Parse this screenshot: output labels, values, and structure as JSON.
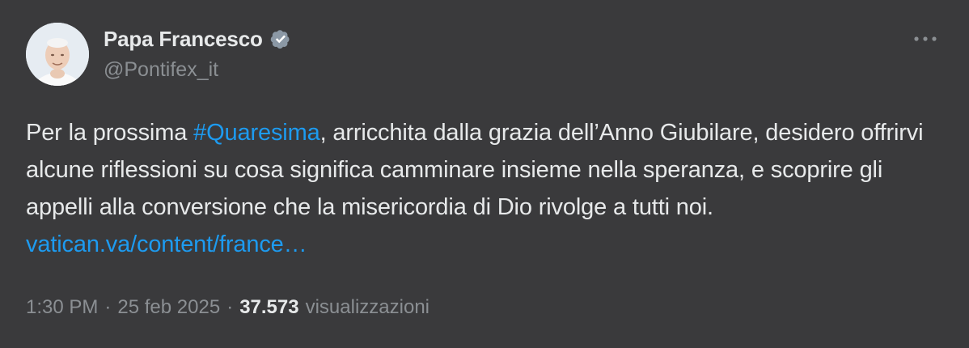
{
  "author": {
    "display_name": "Papa Francesco",
    "handle": "@Pontifex_it",
    "verified_icon": "verified-badge-icon"
  },
  "body": {
    "text_before": "Per la prossima ",
    "hashtag": "#Quaresima",
    "text_after": ", arricchita dalla grazia dell’Anno Giubilare, desidero offrirvi alcune riflessioni su cosa significa camminare insieme nella speranza, e scoprire gli appelli alla conversione che la misericordia di Dio rivolge a tutti noi. ",
    "link": "vatican.va/content/france…"
  },
  "meta": {
    "time": "1:30 PM",
    "date": "25 feb 2025",
    "separator": "·",
    "views_count": "37.573",
    "views_label": "visualizzazioni"
  },
  "colors": {
    "background": "#3a3a3c",
    "text": "#e7e9ea",
    "secondary": "#8b8f93",
    "accent": "#1d9bf0"
  }
}
